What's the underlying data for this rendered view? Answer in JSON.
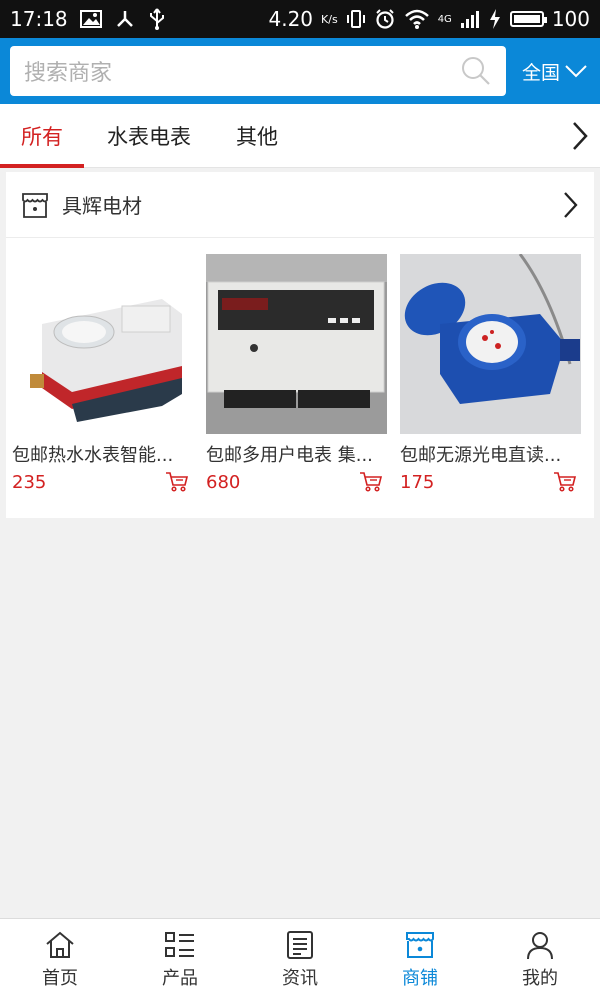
{
  "status_bar": {
    "time": "17:18",
    "speed": "4.20",
    "speed_unit": "K/s",
    "network": "4G",
    "battery_level": "100",
    "battery_fraction": 1.0
  },
  "search": {
    "placeholder": "搜索商家",
    "region_label": "全国"
  },
  "tabs": [
    {
      "label": "所有",
      "active": true
    },
    {
      "label": "水表电表",
      "active": false
    },
    {
      "label": "其他",
      "active": false
    }
  ],
  "store": {
    "name": "具辉电材",
    "products": [
      {
        "title": "包邮热水水表智能...",
        "price": "235"
      },
      {
        "title": "包邮多用户电表 集...",
        "price": "680"
      },
      {
        "title": "包邮无源光电直读...",
        "price": "175"
      }
    ]
  },
  "bottom_nav": [
    {
      "label": "首页",
      "icon": "home-icon",
      "active": false
    },
    {
      "label": "产品",
      "icon": "list-icon",
      "active": false
    },
    {
      "label": "资讯",
      "icon": "news-icon",
      "active": false
    },
    {
      "label": "商铺",
      "icon": "store-icon",
      "active": true
    },
    {
      "label": "我的",
      "icon": "user-icon",
      "active": false
    }
  ],
  "colors": {
    "header_blue": "#0b88d8",
    "accent_red": "#d32121",
    "status_bar": "#111111",
    "background": "#f1f1f1"
  }
}
